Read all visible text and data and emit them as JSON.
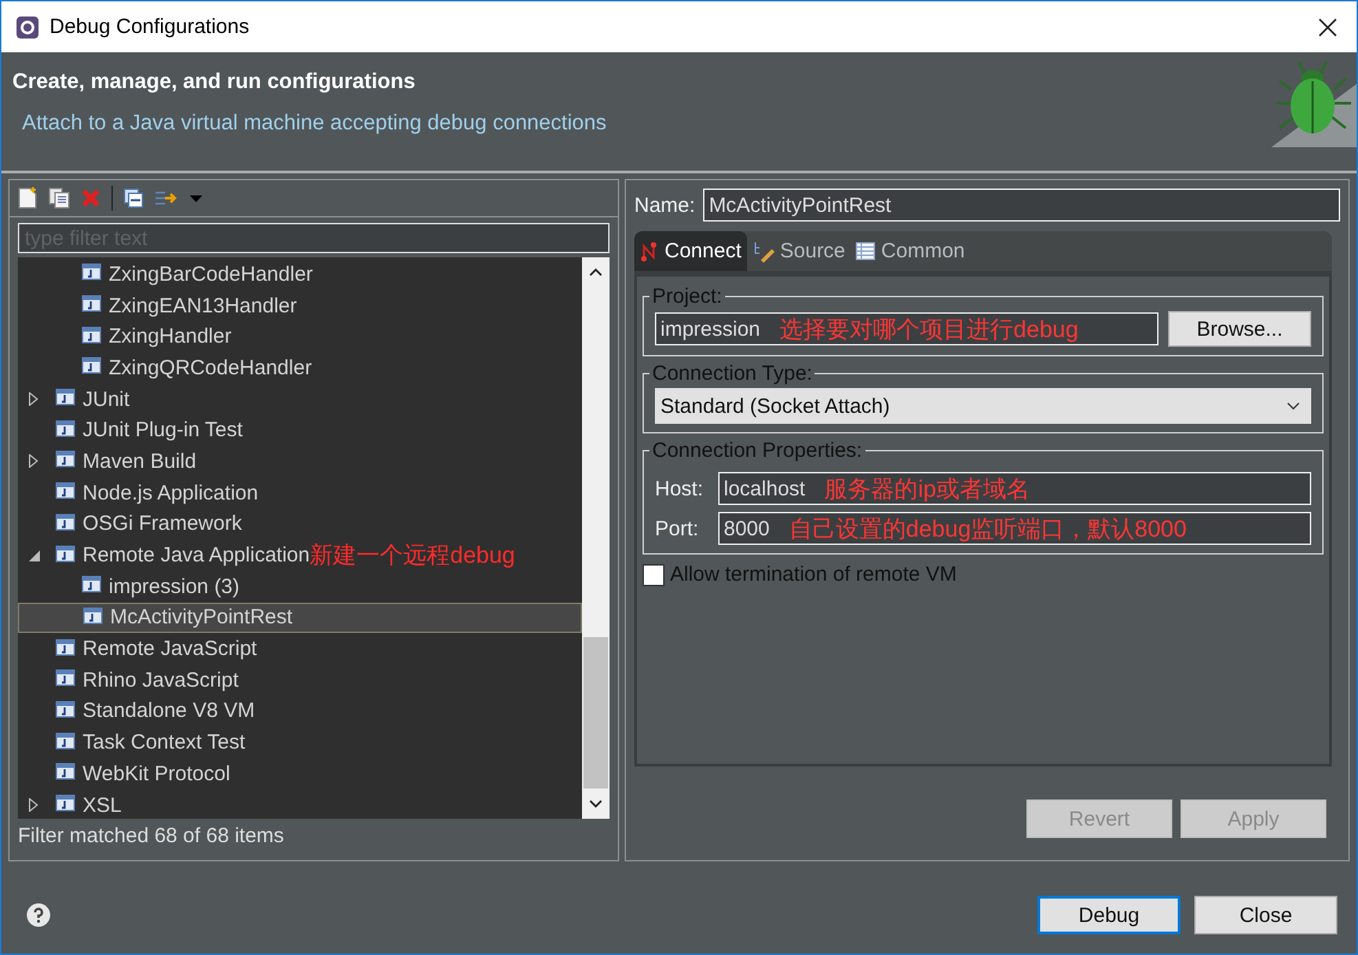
{
  "window": {
    "title": "Debug Configurations"
  },
  "header": {
    "title": "Create, manage, and run configurations",
    "message": "Attach to a Java virtual machine accepting debug connections"
  },
  "filter": {
    "placeholder": "type filter text"
  },
  "tree": [
    {
      "children": [
        {
          "label": "ZxingBarCodeHandler",
          "selected": false
        },
        {
          "label": "ZxingEAN13Handler",
          "selected": false
        },
        {
          "label": "ZxingHandler",
          "selected": false
        },
        {
          "label": "ZxingQRCodeHandler",
          "selected": false
        }
      ]
    },
    {
      "label": "JUnit",
      "expanded": false,
      "selected": false
    },
    {
      "label": "JUnit Plug-in Test",
      "selected": false
    },
    {
      "label": "Maven Build",
      "expanded": false,
      "selected": false
    },
    {
      "label": "Node.js Application",
      "selected": false
    },
    {
      "label": "OSGi Framework",
      "selected": false
    },
    {
      "label": "Remote Java Application",
      "annotation": "新建一个远程debug",
      "expanded": true,
      "selected": false,
      "children": [
        {
          "label": "impression (3)",
          "selected": false
        },
        {
          "label": "McActivityPointRest",
          "selected": true
        }
      ]
    },
    {
      "label": "Remote JavaScript",
      "selected": false
    },
    {
      "label": "Rhino JavaScript",
      "selected": false
    },
    {
      "label": "Standalone V8 VM",
      "selected": false
    },
    {
      "label": "Task Context Test",
      "selected": false
    },
    {
      "label": "WebKit Protocol",
      "selected": false
    },
    {
      "label": "XSL",
      "expanded": false,
      "selected": false
    }
  ],
  "status": "Filter matched 68 of 68 items",
  "name": {
    "label": "Name:",
    "value": "McActivityPointRest"
  },
  "tabs": [
    {
      "label": "Connect",
      "selected": true
    },
    {
      "label": "Source",
      "selected": false
    },
    {
      "label": "Common",
      "selected": false
    }
  ],
  "project": {
    "title": "Project:",
    "value": "impression",
    "annotation": "选择要对哪个项目进行debug",
    "browse": "Browse..."
  },
  "connection_type": {
    "title": "Connection Type:",
    "value": "Standard (Socket Attach)"
  },
  "connection_properties": {
    "title": "Connection Properties:",
    "fields": [
      {
        "label": "Host:",
        "value": "localhost",
        "annotation": "服务器的ip或者域名"
      },
      {
        "label": "Port:",
        "value": "8000",
        "annotation": "自己设置的debug监听端口，默认8000"
      }
    ]
  },
  "allow_termination": {
    "label": "Allow termination of remote VM",
    "checked": false
  },
  "panel_buttons": [
    {
      "label": "Revert",
      "disabled": true
    },
    {
      "label": "Apply",
      "disabled": true
    }
  ],
  "dialog_buttons": [
    {
      "label": "Debug",
      "default": true
    },
    {
      "label": "Close",
      "default": false
    }
  ]
}
